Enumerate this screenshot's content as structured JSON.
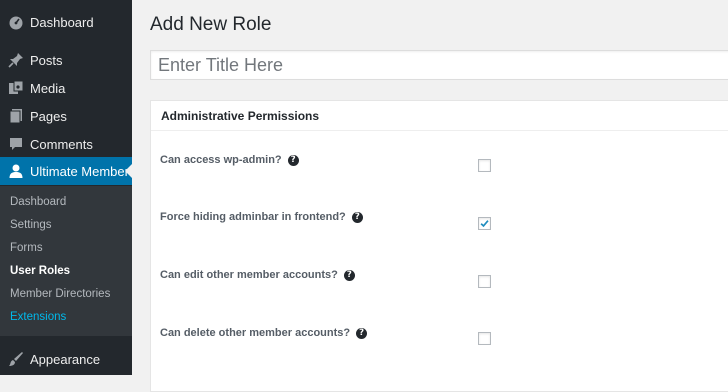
{
  "sidebar": {
    "items": [
      {
        "label": "Dashboard",
        "icon": "dashboard-icon"
      },
      {
        "label": "Posts",
        "icon": "pin-icon"
      },
      {
        "label": "Media",
        "icon": "media-icon"
      },
      {
        "label": "Pages",
        "icon": "pages-icon"
      },
      {
        "label": "Comments",
        "icon": "comment-icon"
      },
      {
        "label": "Ultimate Member",
        "icon": "user-icon"
      },
      {
        "label": "Appearance",
        "icon": "brush-icon"
      }
    ],
    "submenu": [
      {
        "label": "Dashboard"
      },
      {
        "label": "Settings"
      },
      {
        "label": "Forms"
      },
      {
        "label": "User Roles"
      },
      {
        "label": "Member Directories"
      },
      {
        "label": "Extensions"
      }
    ],
    "active_color": "#0073aa",
    "extensions_color": "#00b9eb"
  },
  "main": {
    "title": "Add New Role",
    "title_placeholder": "Enter Title Here",
    "box_title": "Administrative Permissions",
    "permissions": [
      {
        "label": "Can access wp-admin?",
        "checked": false
      },
      {
        "label": "Force hiding adminbar in frontend?",
        "checked": true
      },
      {
        "label": "Can edit other member accounts?",
        "checked": false
      },
      {
        "label": "Can delete other member accounts?",
        "checked": false
      }
    ],
    "help_glyph": "?"
  }
}
